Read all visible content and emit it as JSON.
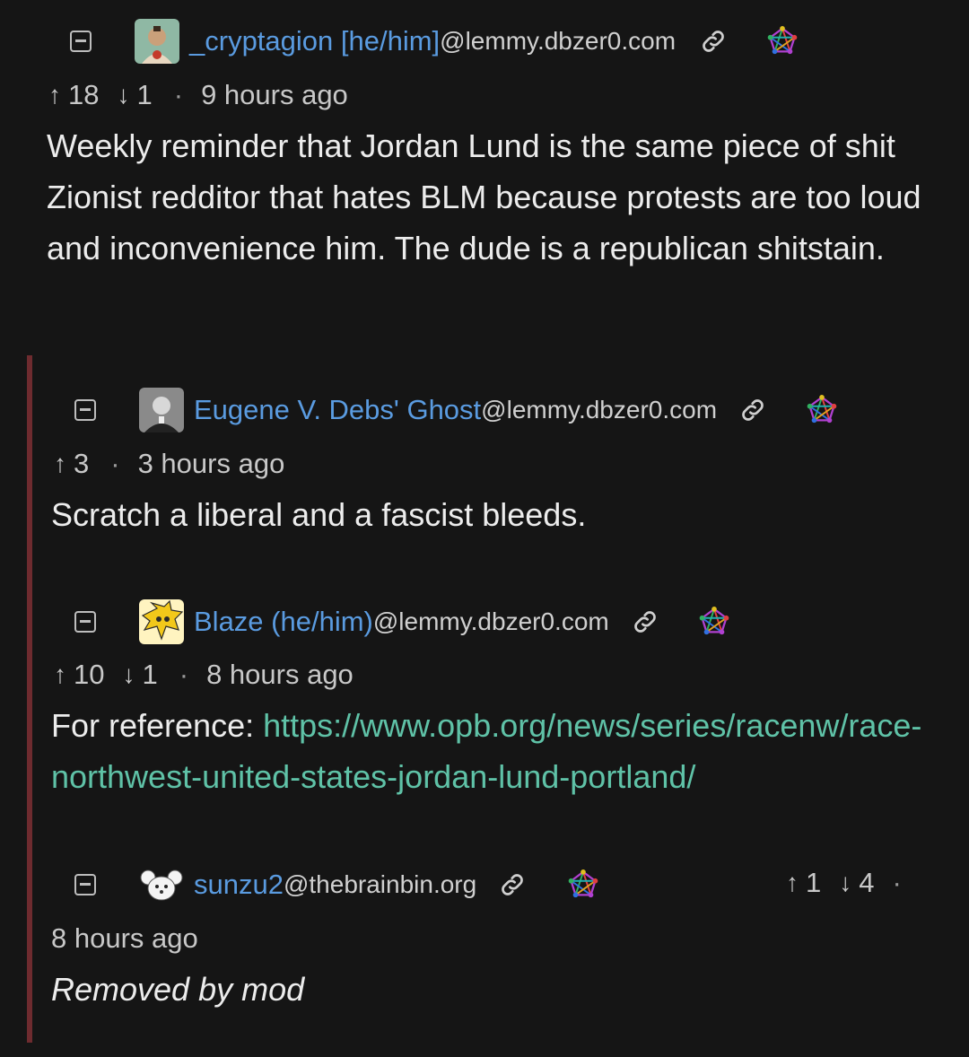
{
  "comments": [
    {
      "username": "_cryptagion [he/him]",
      "instance": "@lemmy.dbzer0.com",
      "upvotes": "18",
      "downvotes": "1",
      "time": "9 hours ago",
      "text": "Weekly reminder that Jordan Lund is the same piece of shit Zionist redditor that hates BLM because protests are too loud and inconvenience him. The dude is a republican shitstain."
    },
    {
      "username": "Eugene V. Debs' Ghost",
      "instance": "@lemmy.dbzer0.com",
      "upvotes": "3",
      "time": "3 hours ago",
      "text": "Scratch a liberal and a fascist bleeds."
    },
    {
      "username": "Blaze (he/him)",
      "instance": "@lemmy.dbzer0.com",
      "upvotes": "10",
      "downvotes": "1",
      "time": "8 hours ago",
      "text_prefix": "For reference: ",
      "link": "https://www.opb.org/news/series/racenw/race-northwest-united-states-jordan-lund-portland/"
    },
    {
      "username": "sunzu2",
      "instance": "@thebrainbin.org",
      "upvotes": "1",
      "downvotes": "4",
      "time": "8 hours ago",
      "text": "Removed by mod"
    }
  ],
  "icons": {
    "up": "↑",
    "down": "↓",
    "dot": "·",
    "collapse": "collapse-icon",
    "link": "link-icon",
    "fediverse": "fediverse-icon"
  },
  "colors": {
    "background": "#151515",
    "username": "#5a9be0",
    "link": "#5fc2a7",
    "thread_bar": "#6e2b2f"
  }
}
